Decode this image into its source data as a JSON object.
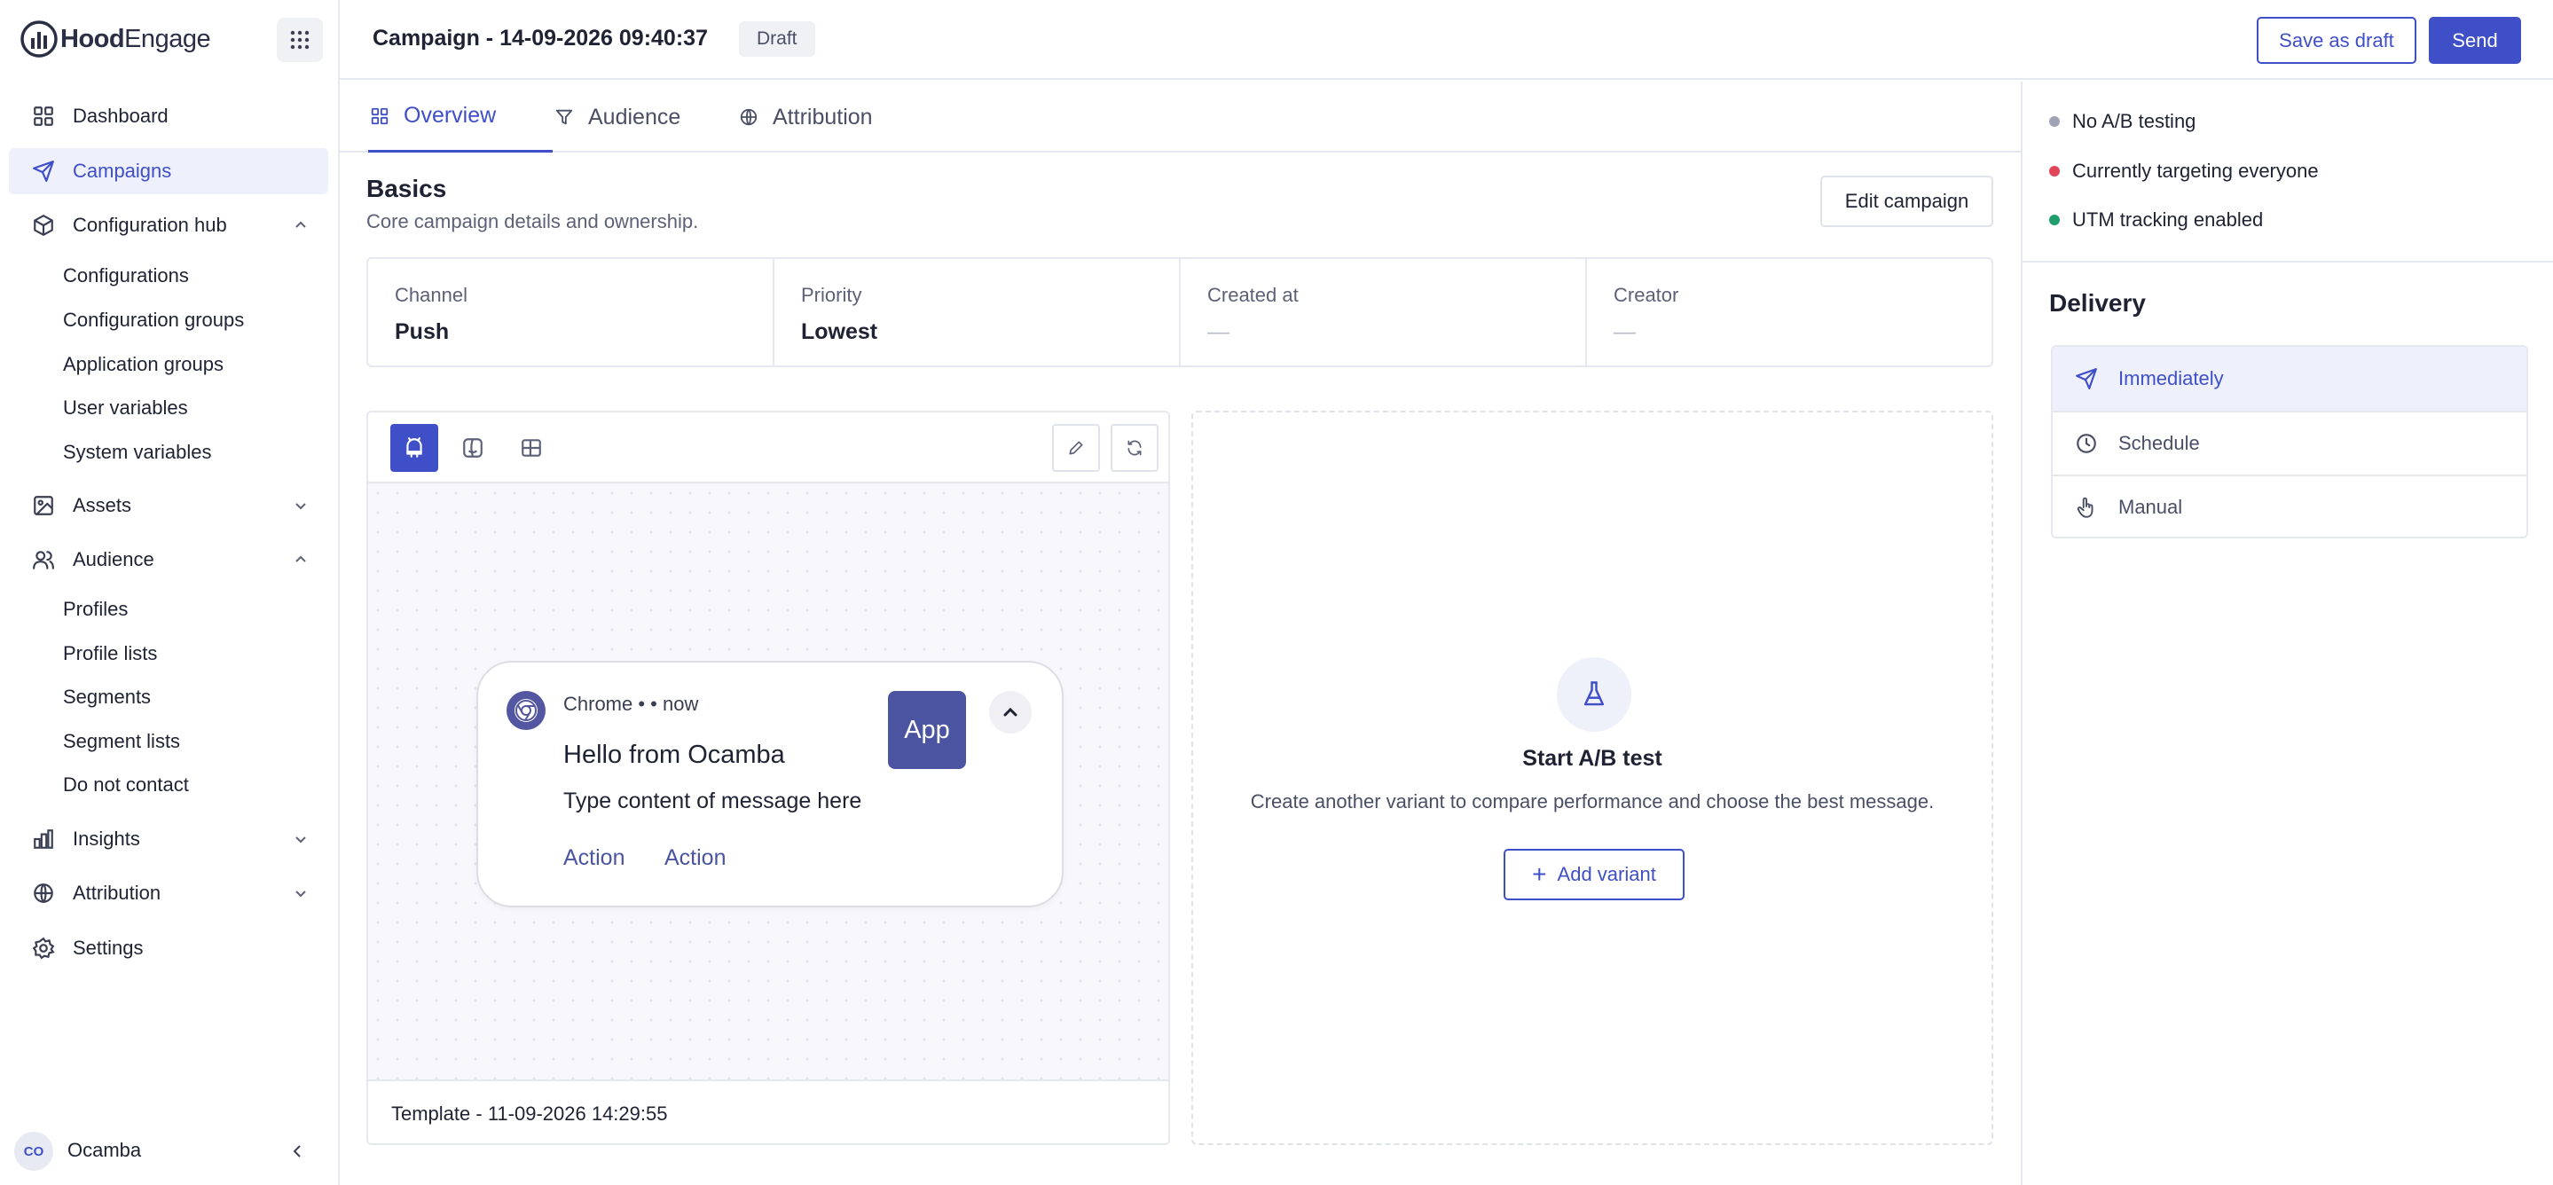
{
  "brand": {
    "name_bold": "Hood",
    "name_rest": "Engage"
  },
  "sidebar": {
    "items": [
      {
        "label": "Dashboard",
        "icon": "grid-icon"
      },
      {
        "label": "Campaigns",
        "icon": "send-icon",
        "active": true
      },
      {
        "label": "Configuration hub",
        "icon": "cube-icon",
        "expanded": true
      },
      {
        "label": "Assets",
        "icon": "image-icon"
      },
      {
        "label": "Audience",
        "icon": "users-icon",
        "expanded": true
      },
      {
        "label": "Insights",
        "icon": "bar-chart-icon"
      },
      {
        "label": "Attribution",
        "icon": "globe-icon"
      },
      {
        "label": "Settings",
        "icon": "gear-icon"
      }
    ],
    "config_sub": [
      "Configurations",
      "Configuration groups",
      "Application groups",
      "User variables",
      "System variables"
    ],
    "audience_sub": [
      "Profiles",
      "Profile lists",
      "Segments",
      "Segment lists",
      "Do not contact"
    ],
    "user": {
      "initials": "CO",
      "name": "Ocamba"
    }
  },
  "header": {
    "title": "Campaign - 14-09-2026 09:40:37",
    "badge": "Draft",
    "save_draft_label": "Save as draft",
    "send_label": "Send"
  },
  "tabs": [
    {
      "label": "Overview",
      "icon": "grid-icon",
      "active": true
    },
    {
      "label": "Audience",
      "icon": "filter-icon"
    },
    {
      "label": "Attribution",
      "icon": "globe-icon"
    }
  ],
  "basics": {
    "title": "Basics",
    "subtitle": "Core campaign details and ownership.",
    "edit_label": "Edit campaign",
    "fields": [
      {
        "key": "Channel",
        "value": "Push"
      },
      {
        "key": "Priority",
        "value": "Lowest"
      },
      {
        "key": "Created at",
        "value": "—"
      },
      {
        "key": "Creator",
        "value": "—"
      }
    ]
  },
  "preview": {
    "meta": "Chrome •  • now",
    "title": "Hello from Ocamba",
    "body": "Type content of message here",
    "action1": "Action",
    "action2": "Action",
    "app_label": "App",
    "template": "Template - 11-09-2026 14:29:55"
  },
  "ab_test": {
    "title": "Start A/B test",
    "subtitle": "Create another variant to compare performance and choose the best message.",
    "add_label": "Add variant"
  },
  "status": [
    {
      "text": "No A/B testing",
      "color": "#a0a3b5"
    },
    {
      "text": "Currently targeting everyone",
      "color": "#e0455a"
    },
    {
      "text": "UTM tracking enabled",
      "color": "#1f9d6b"
    }
  ],
  "delivery": {
    "title": "Delivery",
    "options": [
      {
        "label": "Immediately",
        "icon": "send-icon",
        "active": true
      },
      {
        "label": "Schedule",
        "icon": "clock-icon"
      },
      {
        "label": "Manual",
        "icon": "hand-pointer-icon"
      }
    ]
  },
  "colors": {
    "accent": "#3f4fc8",
    "accent_bg": "#eef0fb",
    "preview_app": "#4a54a0"
  }
}
